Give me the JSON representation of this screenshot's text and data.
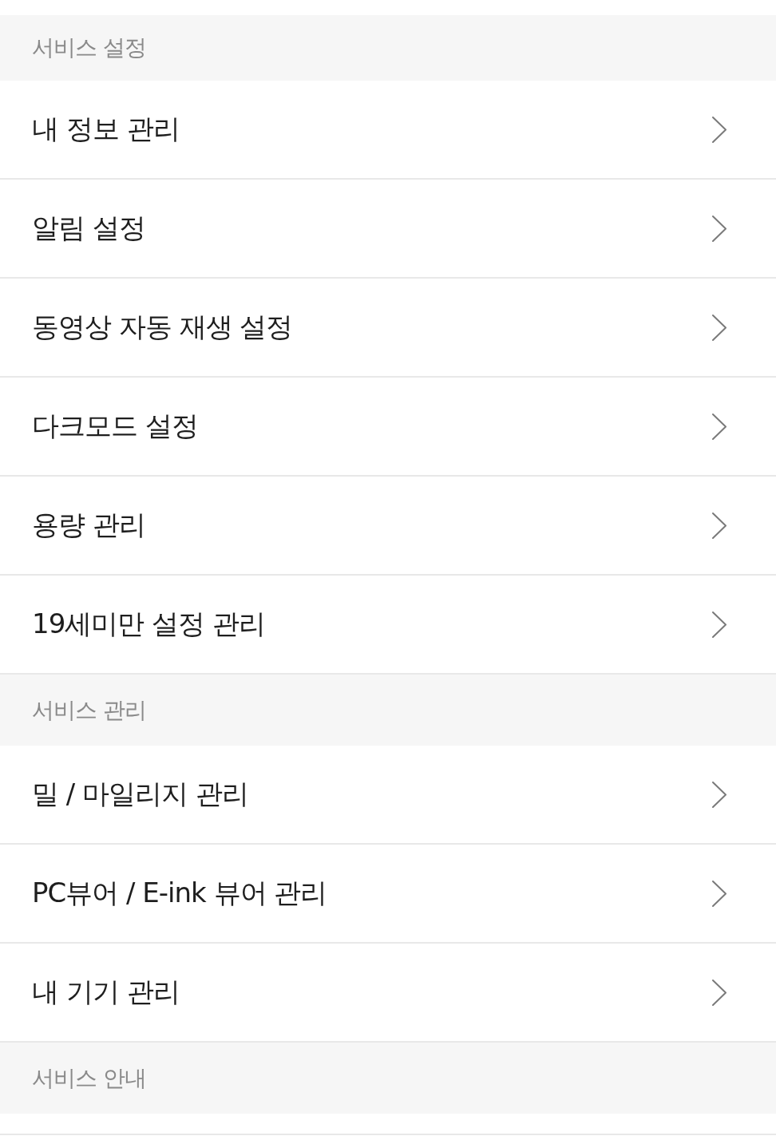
{
  "sections": [
    {
      "title": "서비스 설정",
      "items": [
        {
          "label": "내 정보 관리"
        },
        {
          "label": "알림 설정"
        },
        {
          "label": "동영상 자동 재생 설정"
        },
        {
          "label": "다크모드 설정"
        },
        {
          "label": "용량 관리"
        },
        {
          "label": "19세미만 설정 관리"
        }
      ]
    },
    {
      "title": "서비스 관리",
      "items": [
        {
          "label": "밀 / 마일리지 관리"
        },
        {
          "label": "PC뷰어 / E-ink 뷰어 관리"
        },
        {
          "label": "내 기기 관리"
        }
      ]
    },
    {
      "title": "서비스 안내"
    }
  ]
}
